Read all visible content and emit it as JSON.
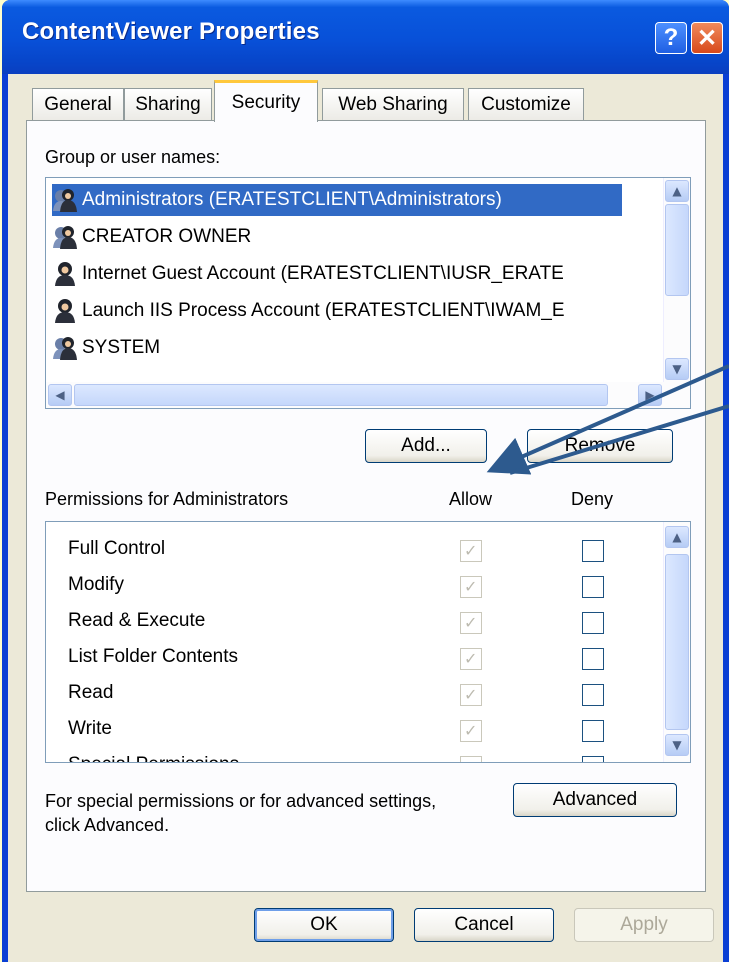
{
  "window": {
    "title": "ContentViewer Properties"
  },
  "titlebar": {
    "help_label": "?",
    "close_label": "✕"
  },
  "tabs": [
    "General",
    "Sharing",
    "Security",
    "Web Sharing",
    "Customize"
  ],
  "security": {
    "group_label": "Group or user names:",
    "users": [
      {
        "name": "Administrators (ERATESTCLIENT\\Administrators)",
        "icon": "group-icon",
        "selected": true
      },
      {
        "name": "CREATOR OWNER",
        "icon": "group-icon",
        "selected": false
      },
      {
        "name": "Internet Guest Account (ERATESTCLIENT\\IUSR_ERATE",
        "icon": "user-icon",
        "selected": false
      },
      {
        "name": "Launch IIS Process Account (ERATESTCLIENT\\IWAM_E",
        "icon": "user-icon",
        "selected": false
      },
      {
        "name": "SYSTEM",
        "icon": "group-icon",
        "selected": false
      }
    ],
    "add_label": "Add...",
    "remove_label": "Remove",
    "permissions_label": "Permissions for Administrators",
    "allow_label": "Allow",
    "deny_label": "Deny",
    "permissions": [
      {
        "name": "Full Control",
        "allow": true,
        "deny": false
      },
      {
        "name": "Modify",
        "allow": true,
        "deny": false
      },
      {
        "name": "Read & Execute",
        "allow": true,
        "deny": false
      },
      {
        "name": "List Folder Contents",
        "allow": true,
        "deny": false
      },
      {
        "name": "Read",
        "allow": true,
        "deny": false
      },
      {
        "name": "Write",
        "allow": true,
        "deny": false
      },
      {
        "name": "Special Permissions",
        "allow": false,
        "deny": false
      }
    ],
    "advanced_note": "For special permissions or for advanced settings,",
    "advanced_note2": "click Advanced.",
    "advanced_label": "Advanced"
  },
  "footer": {
    "ok_label": "OK",
    "cancel_label": "Cancel",
    "apply_label": "Apply"
  },
  "colors": {
    "titlebar": "#0850d8",
    "selection": "#316ac5",
    "dialog_bg": "#ece9d8",
    "arrow": "#2d5a8e",
    "page_bg": "#ffffcc"
  }
}
